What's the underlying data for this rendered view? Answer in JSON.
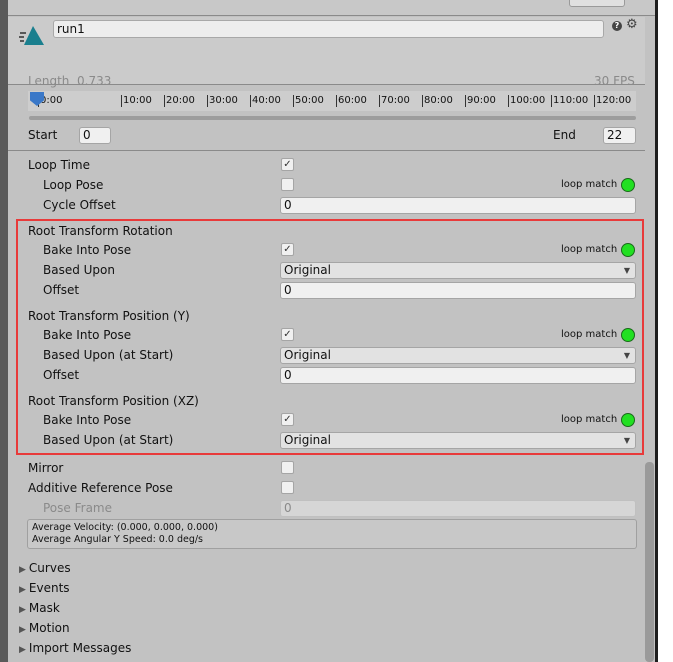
{
  "clip": {
    "name": "run1",
    "length_label": "Length",
    "length": "0.733",
    "fps": "30 FPS",
    "timeline_ticks": [
      "0:00",
      "10:00",
      "20:00",
      "30:00",
      "40:00",
      "50:00",
      "60:00",
      "70:00",
      "80:00",
      "90:00",
      "100:00",
      "110:00",
      "120:00",
      "130:00"
    ],
    "start_label": "Start",
    "start": "0",
    "end_label": "End",
    "end": "22"
  },
  "loop": {
    "loop_time": "Loop Time",
    "loop_time_checked": true,
    "loop_pose": "Loop Pose",
    "loop_pose_checked": false,
    "loop_match": "loop match",
    "cycle_offset": "Cycle Offset",
    "cycle_offset_value": "0"
  },
  "rot": {
    "title": "Root Transform Rotation",
    "bake": "Bake Into Pose",
    "based": "Based Upon",
    "based_value": "Original",
    "offset": "Offset",
    "offset_value": "0",
    "loop_match": "loop match"
  },
  "posy": {
    "title": "Root Transform Position (Y)",
    "bake": "Bake Into Pose",
    "based": "Based Upon (at Start)",
    "based_value": "Original",
    "offset": "Offset",
    "offset_value": "0",
    "loop_match": "loop match"
  },
  "posxz": {
    "title": "Root Transform Position (XZ)",
    "bake": "Bake Into Pose",
    "based": "Based Upon (at Start)",
    "based_value": "Original",
    "loop_match": "loop match"
  },
  "misc": {
    "mirror": "Mirror",
    "additive": "Additive Reference Pose",
    "pose_frame": "Pose Frame",
    "pose_frame_value": "0",
    "info1": "Average Velocity: (0.000, 0.000, 0.000)",
    "info2": "Average Angular Y Speed: 0.0 deg/s"
  },
  "sections": [
    "Curves",
    "Events",
    "Mask",
    "Motion",
    "Import Messages"
  ],
  "colors": {
    "highlight": "#e83a3a",
    "loop_match_led": "#22e022",
    "icon": "#1a7f8e"
  },
  "checkmark": "✓"
}
